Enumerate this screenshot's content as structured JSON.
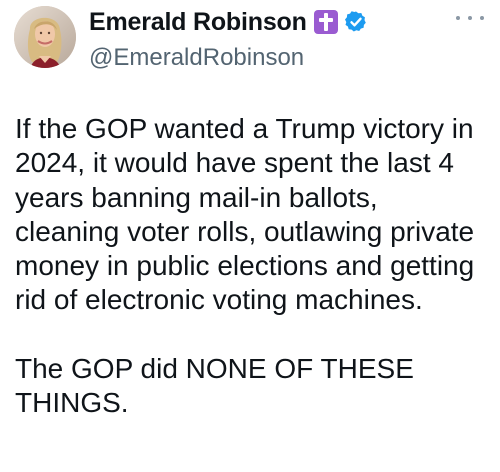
{
  "author": {
    "display_name": "Emerald Robinson",
    "handle": "@EmeraldRobinson",
    "badges": {
      "cross_icon": "purple-cross-icon",
      "verified_icon": "verified-checkmark-icon",
      "badge_colors": {
        "cross_badge": "#9a5bd1",
        "verified": "#1d9bf0"
      }
    },
    "avatar_icon": "profile-avatar"
  },
  "menu": {
    "icon": "more-options-icon"
  },
  "tweet": {
    "paragraph_1": [
      "If the GOP wanted a Trump victory in",
      "2024, it would have spent the last 4",
      "years banning mail-in ballots,",
      "cleaning voter rolls, outlawing private",
      "money in public elections and getting",
      "rid of electronic voting machines."
    ],
    "paragraph_2": [
      "The GOP did NONE OF THESE",
      "THINGS."
    ]
  }
}
